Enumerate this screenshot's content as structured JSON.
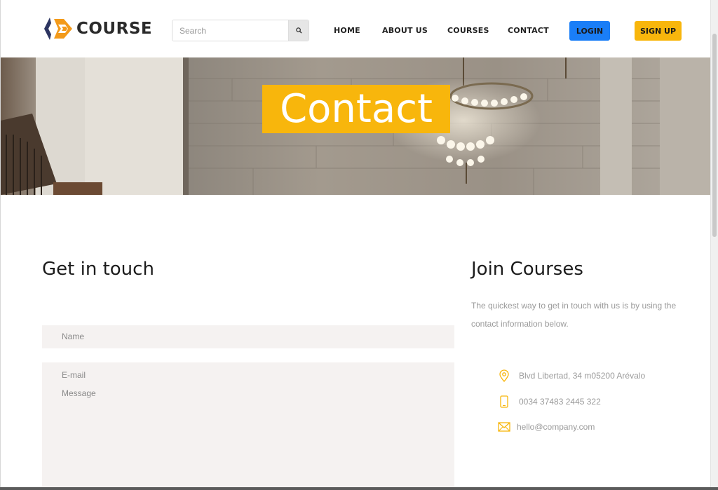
{
  "brand": {
    "name": "COURSE",
    "accent": "#f8b60c",
    "dark": "#2d3561"
  },
  "search": {
    "placeholder": "Search",
    "icon": "search-icon"
  },
  "nav": {
    "items": [
      {
        "label": "HOME"
      },
      {
        "label": "ABOUT US"
      },
      {
        "label": "COURSES"
      },
      {
        "label": "CONTACT"
      }
    ],
    "login_label": "LOGIN",
    "signup_label": "SIGN UP",
    "login_color": "#1a7ef7",
    "signup_color": "#f8b60c"
  },
  "hero": {
    "title": "Contact"
  },
  "form": {
    "heading": "Get in touch",
    "name_placeholder": "Name",
    "email_placeholder": "E-mail",
    "message_placeholder": "Message"
  },
  "info": {
    "heading": "Join Courses",
    "intro": "The quickest way to get in touch with us is by using the contact information below.",
    "address": "Blvd Libertad, 34 m05200 Arévalo",
    "phone": "0034 37483 2445 322",
    "email": "hello@company.com",
    "icons": [
      "map-pin-icon",
      "phone-icon",
      "envelope-icon"
    ]
  }
}
